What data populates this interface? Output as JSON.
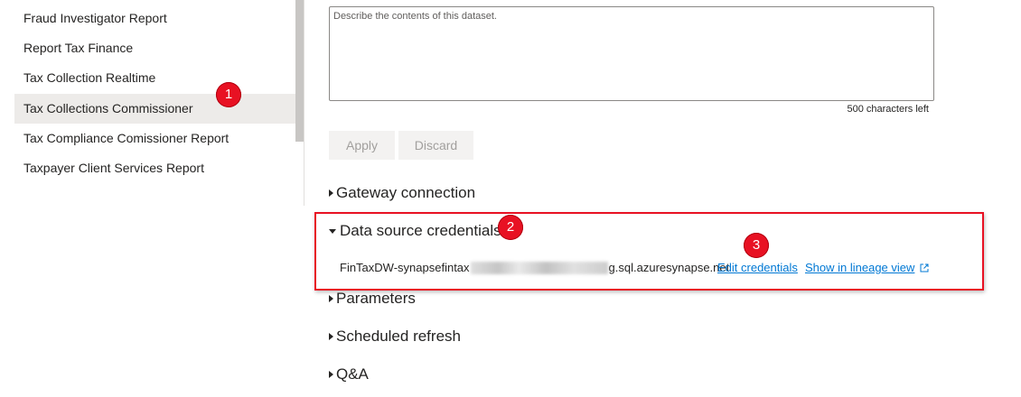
{
  "sidebar": {
    "items": [
      {
        "label": "Fraud Investigator Report",
        "selected": false
      },
      {
        "label": "Report Tax Finance",
        "selected": false
      },
      {
        "label": "Tax Collection Realtime",
        "selected": false
      },
      {
        "label": "Tax Collections Commissioner",
        "selected": true
      },
      {
        "label": "Tax Compliance Comissioner Report",
        "selected": false
      },
      {
        "label": "Taxpayer Client Services Report",
        "selected": false
      }
    ]
  },
  "description": {
    "placeholder": "Describe the contents of this dataset.",
    "value": "",
    "chars_left": "500 characters left"
  },
  "buttons": {
    "apply": "Apply",
    "discard": "Discard"
  },
  "sections": {
    "gateway": "Gateway connection",
    "credentials": "Data source credentials",
    "parameters": "Parameters",
    "scheduled_refresh": "Scheduled refresh",
    "qa": "Q&A"
  },
  "credentials": {
    "source_prefix": "FinTaxDW-synapsefintax",
    "source_suffix": "g.sql.azuresynapse.net",
    "edit_label": "Edit credentials",
    "lineage_label": "Show in lineage view"
  },
  "callouts": {
    "one": "1",
    "two": "2",
    "three": "3"
  },
  "colors": {
    "accent": "#0078d4",
    "callout": "#e81123",
    "selected_bg": "#edebe9"
  }
}
